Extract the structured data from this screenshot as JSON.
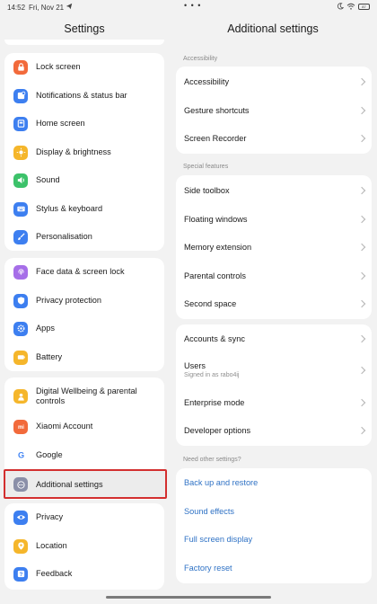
{
  "status_bar": {
    "time": "14:52",
    "date": "Fri, Nov 21",
    "battery": "87"
  },
  "left": {
    "title": "Settings",
    "items": [
      {
        "label": "Lock screen",
        "icon": "lock-icon",
        "color": "#f26a3b"
      },
      {
        "label": "Notifications & status bar",
        "icon": "notification-icon",
        "color": "#3d7ff0"
      },
      {
        "label": "Home screen",
        "icon": "home-icon",
        "color": "#3d7ff0"
      },
      {
        "label": "Display & brightness",
        "icon": "sun-icon",
        "color": "#f5b62b"
      },
      {
        "label": "Sound",
        "icon": "speaker-icon",
        "color": "#3cc26a"
      },
      {
        "label": "Stylus & keyboard",
        "icon": "keyboard-icon",
        "color": "#3d7ff0"
      },
      {
        "label": "Personalisation",
        "icon": "brush-icon",
        "color": "#3d7ff0"
      },
      {
        "label": "Face data & screen lock",
        "icon": "fingerprint-icon",
        "color": "#a66ee8"
      },
      {
        "label": "Privacy protection",
        "icon": "shield-icon",
        "color": "#3d7ff0"
      },
      {
        "label": "Apps",
        "icon": "gear-icon",
        "color": "#3d7ff0"
      },
      {
        "label": "Battery",
        "icon": "battery-icon",
        "color": "#f5b62b"
      },
      {
        "label": "Digital Wellbeing & parental controls",
        "icon": "person-icon",
        "color": "#f5b62b"
      },
      {
        "label": "Xiaomi Account",
        "icon": "mi-icon",
        "color": "#f26a3b"
      },
      {
        "label": "Google",
        "icon": "google-icon",
        "color": "#ffffff"
      },
      {
        "label": "Additional settings",
        "icon": "more-icon",
        "color": "#8a8fa8"
      },
      {
        "label": "Privacy",
        "icon": "eye-icon",
        "color": "#3d7ff0"
      },
      {
        "label": "Location",
        "icon": "location-icon",
        "color": "#f5b62b"
      },
      {
        "label": "Feedback",
        "icon": "feedback-icon",
        "color": "#3d7ff0"
      }
    ]
  },
  "right": {
    "title": "Additional settings",
    "sections": {
      "accessibility": "Accessibility",
      "special": "Special features",
      "other": "Need other settings?"
    },
    "accessibility_items": [
      "Accessibility",
      "Gesture shortcuts",
      "Screen Recorder"
    ],
    "special_items": [
      "Side toolbox",
      "Floating windows",
      "Memory extension",
      "Parental controls",
      "Second space"
    ],
    "account_items": [
      {
        "label": "Accounts & sync"
      },
      {
        "label": "Users",
        "sub": "Signed in as rabo4ij"
      },
      {
        "label": "Enterprise mode"
      },
      {
        "label": "Developer options"
      }
    ],
    "other_links": [
      "Back up and restore",
      "Sound effects",
      "Full screen display",
      "Factory reset"
    ]
  }
}
